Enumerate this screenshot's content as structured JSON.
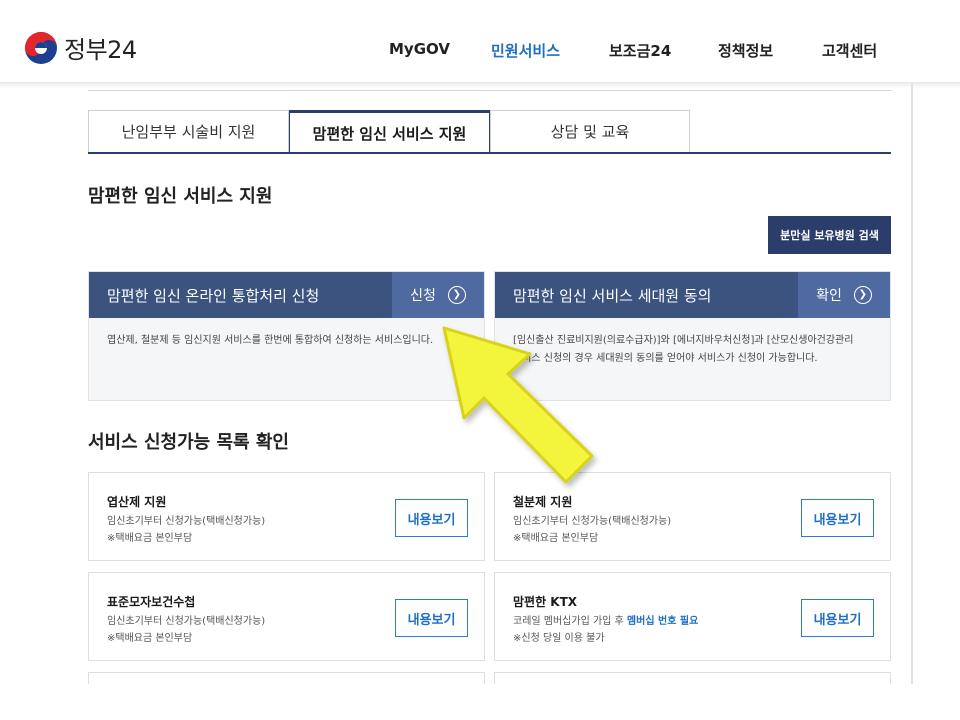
{
  "header": {
    "logo_text": "정부24",
    "nav": [
      "MyGOV",
      "민원서비스",
      "보조금24",
      "정책정보",
      "고객센터"
    ],
    "active_nav": "민원서비스"
  },
  "tabs": [
    "난임부부 시술비 지원",
    "맘편한 임신 서비스 지원",
    "상담 및 교육"
  ],
  "section_title": "맘편한 임신 서비스 지원",
  "hospital_search_label": "분만실 보유병원 검색",
  "services": [
    {
      "title": "맘편한 임신 온라인 통합처리 신청",
      "action": "신청",
      "desc": "엽산제, 철분제 등 임신지원 서비스를 한번에 통합하여 신청하는 서비스입니다."
    },
    {
      "title": "맘편한 임신 서비스 세대원 동의",
      "action": "확인",
      "desc_line1": "[임신출산 진료비지원(의료수급자)]와 [에너지바우처신청]과 [산모신생아건강관리",
      "desc_line2": "서비스 신청의 경우 세대원의 동의를 얻어야 서비스가 신청이 가능합니다."
    }
  ],
  "list_title": "서비스 신청가능 목록 확인",
  "cards": [
    {
      "name": "엽산제 지원",
      "line1": "임신초기부터 신청가능(택배신청가능)",
      "line2": "※택배요금 본인부담",
      "button": "내용보기"
    },
    {
      "name": "철분제 지원",
      "line1": "임신초기부터 신청가능(택배신청가능)",
      "line2": "※택배요금 본인부담",
      "button": "내용보기"
    },
    {
      "name": "표준모자보건수첩",
      "line1": "임신초기부터 신청가능(택배신청가능)",
      "line2": "※택배요금 본인부담",
      "button": "내용보기"
    },
    {
      "name": "맘편한 KTX",
      "line1_prefix": "코레일 멤버십가입 가입 후 ",
      "line1_highlight": "멤버십 번호 필요",
      "line2": "※신청 당일 이용 불가",
      "button": "내용보기"
    }
  ],
  "colors": {
    "navy": "#2b3d6a",
    "service_head": "#3c5380",
    "accent_blue": "#1f6fc4",
    "arrow_yellow": "#f2f53a"
  }
}
